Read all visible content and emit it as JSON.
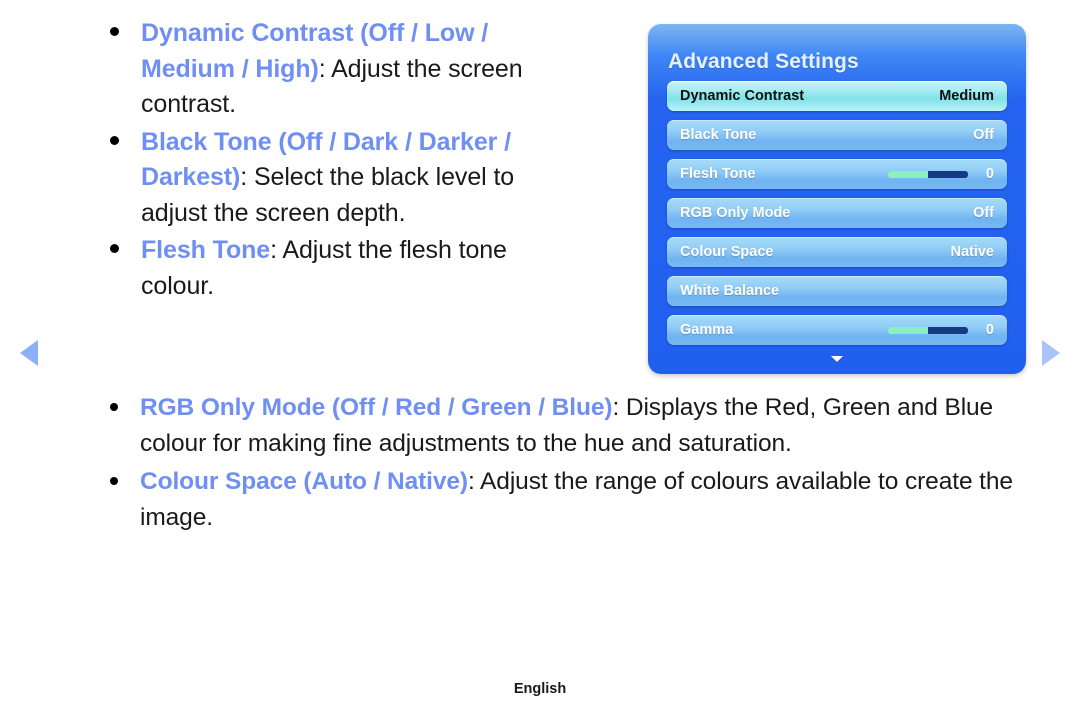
{
  "nav": {
    "prev_label": "Previous page",
    "next_label": "Next page"
  },
  "colors": {
    "accent_term": "#6f8ff5",
    "panel_blue": "#2563f0",
    "row_blue": "#92cdf6",
    "selected_cyan": "#a8ecf0",
    "slider_fill": "#8defc0",
    "slider_rest": "#123b82",
    "arrow_blue": "#8cb0f7"
  },
  "bullets_top": [
    {
      "term": "Dynamic Contrast (Off / Low / Medium / High)",
      "description": ": Adjust the screen contrast."
    },
    {
      "term": "Black Tone (Off / Dark / Darker / Darkest)",
      "description": ": Select the black level to adjust the screen depth."
    },
    {
      "term": "Flesh Tone",
      "description": ": Adjust the flesh tone colour."
    }
  ],
  "bullets_bottom": [
    {
      "term": "RGB Only Mode (Off / Red / Green / Blue)",
      "description": ": Displays the Red, Green and Blue colour for making fine adjustments to the hue and saturation."
    },
    {
      "term": "Colour Space (Auto / Native)",
      "description": ": Adjust the range of colours available to create the image."
    }
  ],
  "osd": {
    "title": "Advanced Settings",
    "scroll_down_icon": "triangle-down-icon",
    "rows": [
      {
        "label": "Dynamic Contrast",
        "value": "Medium",
        "type": "value",
        "selected": true
      },
      {
        "label": "Black Tone",
        "value": "Off",
        "type": "value",
        "selected": false
      },
      {
        "label": "Flesh Tone",
        "value": "0",
        "type": "slider",
        "fill_percent": 50,
        "selected": false
      },
      {
        "label": "RGB Only Mode",
        "value": "Off",
        "type": "value",
        "selected": false
      },
      {
        "label": "Colour Space",
        "value": "Native",
        "type": "value",
        "selected": false
      },
      {
        "label": "White Balance",
        "value": "",
        "type": "none",
        "selected": false
      },
      {
        "label": "Gamma",
        "value": "0",
        "type": "slider",
        "fill_percent": 50,
        "selected": false
      }
    ]
  },
  "footer": {
    "language": "English"
  }
}
